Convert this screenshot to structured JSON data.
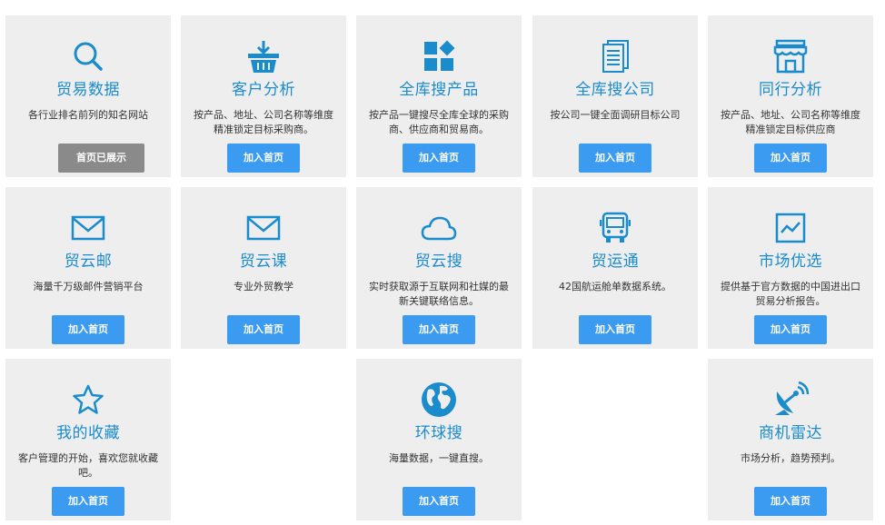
{
  "colors": {
    "accent": "#1a8ccc",
    "button": "#3b9bf0",
    "button_disabled": "#8a8a8a",
    "card_bg": "#eeeeee"
  },
  "cards": [
    {
      "title": "贸易数据",
      "desc": "各行业排名前列的知名网站",
      "button": "首页已展示",
      "icon": "search-icon"
    },
    {
      "title": "客户分析",
      "desc": "按产品、地址、公司名称等维度精准锁定目标采购商。",
      "button": "加入首页",
      "icon": "basket-icon"
    },
    {
      "title": "全库搜产品",
      "desc": "按产品一键搜尽全库全球的采购商、供应商和贸易商。",
      "button": "加入首页",
      "icon": "blocks-icon"
    },
    {
      "title": "全库搜公司",
      "desc": "按公司一键全面调研目标公司",
      "button": "加入首页",
      "icon": "document-icon"
    },
    {
      "title": "同行分析",
      "desc": "按产品、地址、公司名称等维度精准锁定目标供应商",
      "button": "加入首页",
      "icon": "store-icon"
    },
    {
      "title": "贸云邮",
      "desc": "海量千万级邮件营销平台",
      "button": "加入首页",
      "icon": "mail-icon"
    },
    {
      "title": "贸云课",
      "desc": "专业外贸教学",
      "button": "加入首页",
      "icon": "mail-icon"
    },
    {
      "title": "贸云搜",
      "desc": "实时获取源于互联网和社媒的最新关键联络信息。",
      "button": "加入首页",
      "icon": "cloud-icon"
    },
    {
      "title": "贸运通",
      "desc": "42国航运舱单数据系统。",
      "button": "加入首页",
      "icon": "bus-icon"
    },
    {
      "title": "市场优选",
      "desc": "提供基于官方数据的中国进出口贸易分析报告。",
      "button": "加入首页",
      "icon": "chart-icon"
    },
    {
      "title": "我的收藏",
      "desc": "客户管理的开始，喜欢您就收藏吧。",
      "button": "加入首页",
      "icon": "star-icon"
    },
    {
      "title": "环球搜",
      "desc": "海量数据，一键直搜。",
      "button": "加入首页",
      "icon": "globe-icon"
    },
    {
      "title": "商机雷达",
      "desc": "市场分析，趋势预判。",
      "button": "加入首页",
      "icon": "radar-icon"
    }
  ]
}
